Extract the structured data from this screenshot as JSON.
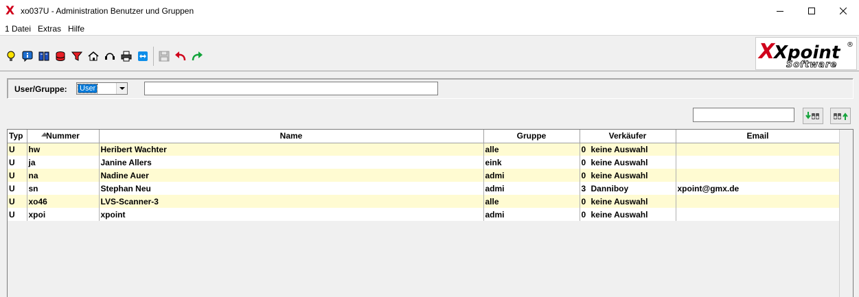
{
  "window": {
    "title": "xo037U - Administration Benutzer und Gruppen"
  },
  "menu": [
    "1 Datei",
    "Extras",
    "Hilfe"
  ],
  "toolbar": {
    "icons": [
      "lightbulb-icon",
      "info-icon",
      "book-icon",
      "database-icon",
      "filter-icon",
      "home-icon",
      "headset-icon",
      "print-icon",
      "teamviewer-icon",
      "save-icon",
      "undo-icon",
      "redo-icon"
    ]
  },
  "logo": {
    "brand": "Xpoint",
    "sub": "Software",
    "mark": "®"
  },
  "filter": {
    "label": "User/Gruppe:",
    "selected": "User",
    "text_value": ""
  },
  "search": {
    "value": ""
  },
  "table": {
    "columns": [
      "Typ",
      "Nummer",
      "Name",
      "Gruppe",
      "Verkäufer",
      "Email"
    ],
    "sort_column": "Nummer",
    "rows": [
      {
        "typ": "U",
        "nummer": "hw",
        "name": "Heribert Wachter",
        "gruppe": "alle",
        "vk_nr": "0",
        "vk_name": "keine Auswahl",
        "email": ""
      },
      {
        "typ": "U",
        "nummer": "ja",
        "name": "Janine Allers",
        "gruppe": "eink",
        "vk_nr": "0",
        "vk_name": "keine Auswahl",
        "email": ""
      },
      {
        "typ": "U",
        "nummer": "na",
        "name": "Nadine Auer",
        "gruppe": "admi",
        "vk_nr": "0",
        "vk_name": "keine Auswahl",
        "email": ""
      },
      {
        "typ": "U",
        "nummer": "sn",
        "name": "Stephan Neu",
        "gruppe": "admi",
        "vk_nr": "3",
        "vk_name": "Danniboy",
        "email": "xpoint@gmx.de"
      },
      {
        "typ": "U",
        "nummer": "xo46",
        "name": "LVS-Scanner-3",
        "gruppe": "alle",
        "vk_nr": "0",
        "vk_name": "keine Auswahl",
        "email": ""
      },
      {
        "typ": "U",
        "nummer": "xpoi",
        "name": "xpoint",
        "gruppe": "admi",
        "vk_nr": "0",
        "vk_name": "keine Auswahl",
        "email": ""
      }
    ]
  },
  "colors": {
    "row_alt": "#fffbd2",
    "accent_red": "#d0021b",
    "selection": "#0078d7"
  }
}
